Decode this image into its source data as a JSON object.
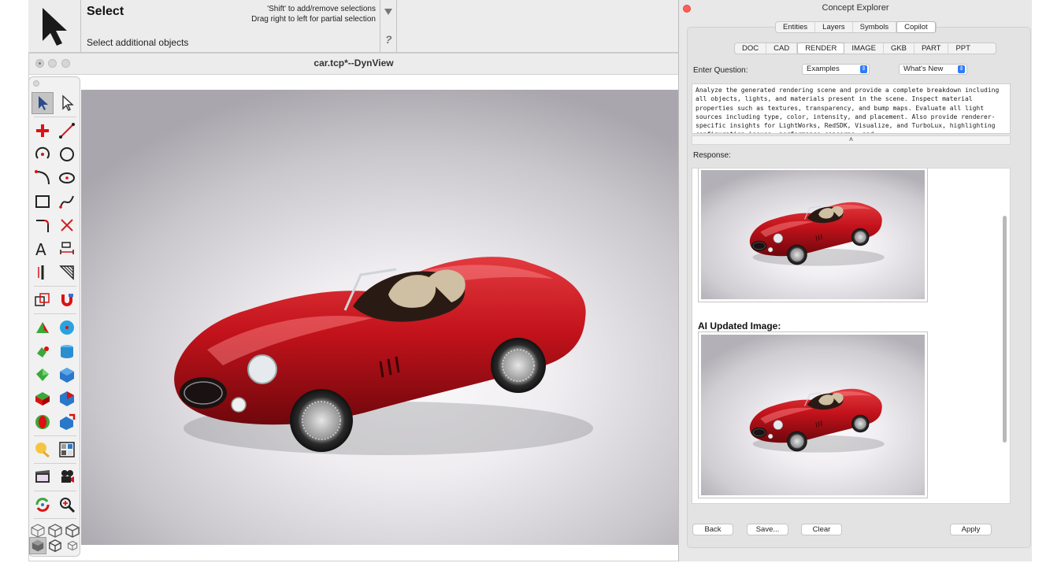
{
  "toolbar": {
    "title": "Select",
    "prompt": "Select additional objects",
    "hint_line1": "'Shift' to add/remove selections",
    "hint_line2": "Drag right to left for partial selection",
    "help": "?"
  },
  "dynview": {
    "title": "car.tcp*--DynView"
  },
  "palette": {
    "icons": [
      "select-arrow-icon",
      "select-hollow-arrow-icon",
      "point-icon",
      "line-icon",
      "arc-icon",
      "circle-icon",
      "curve-icon",
      "ellipse-icon",
      "rectangle-icon",
      "spline-icon",
      "fillet-icon",
      "trim-icon",
      "text-icon",
      "dimension-icon",
      "vertical-line-icon",
      "hatch-icon",
      "copy-icon",
      "magnet-icon",
      "extrude-icon",
      "sphere-icon",
      "revolve-icon",
      "cylinder-icon",
      "surface-icon",
      "box-icon",
      "slice-icon",
      "section-icon",
      "boolean-icon",
      "solid-add-icon",
      "light-icon",
      "render-grid-icon",
      "film-icon",
      "camera-icon",
      "refresh-icon",
      "zoom-icon",
      "wireframe-cube-icon",
      "shaded-cube-icon",
      "hidden-cube-icon",
      "solid-cube-icon",
      "outline-cube-icon",
      "small-cube-icon"
    ]
  },
  "concept_explorer": {
    "title": "Concept Explorer",
    "tabs": [
      "Entities",
      "Layers",
      "Symbols",
      "Copilot"
    ],
    "selected_tab": "Copilot",
    "subtabs": [
      "DOC",
      "CAD",
      "RENDER",
      "IMAGE",
      "GKB",
      "PART",
      "PPT"
    ],
    "selected_subtab": "RENDER",
    "question_label": "Enter Question:",
    "examples_dropdown": "Examples",
    "whats_new_dropdown": "What's New",
    "question_text": "Analyze the generated rendering scene and provide a complete breakdown including all objects, lights, and materials present in the scene. Inspect material properties such as textures, transparency, and bump maps. Evaluate all light sources including type, color, intensity, and placement. Also provide renderer-specific insights for LightWorks, RedSDK, Visualize, and TurboLux, highlighting configuration issues, performance concerns, and",
    "splitter_glyph": "˄",
    "response_label": "Response:",
    "ai_updated_label": "AI Updated Image:",
    "buttons": {
      "back": "Back",
      "save": "Save...",
      "clear": "Clear",
      "apply": "Apply"
    }
  },
  "colors": {
    "car_red": "#c3121b",
    "accent_blue": "#2f7cf6",
    "close_red": "#ff5f57"
  }
}
